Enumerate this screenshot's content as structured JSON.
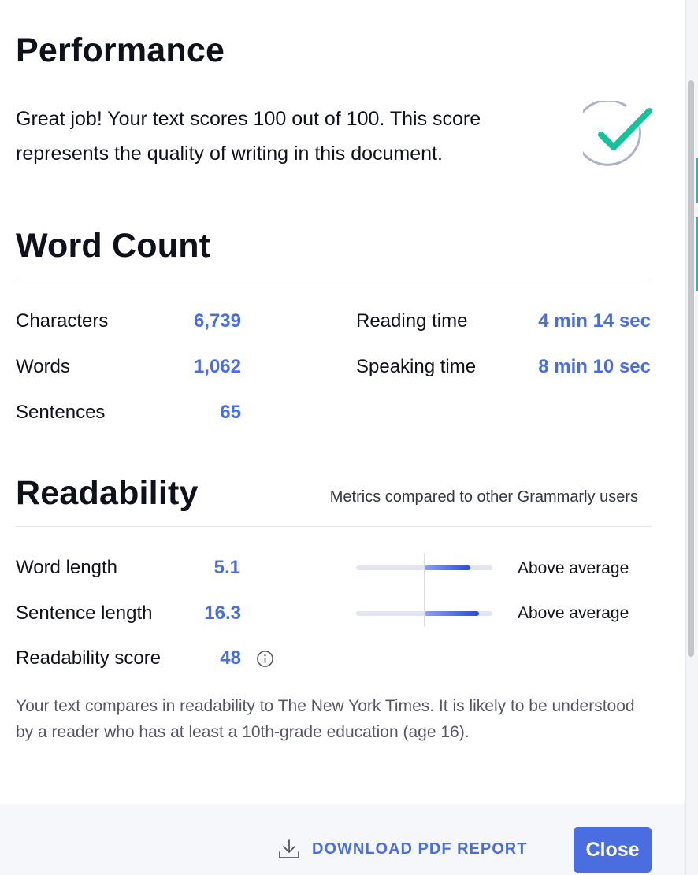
{
  "performance": {
    "title": "Performance",
    "text": "Great job! Your text scores 100 out of 100. This score represents the quality of writing in this document.",
    "icon": "check-circle-icon",
    "colors": {
      "check": "#15c39a",
      "ring": "#aab2cc"
    }
  },
  "word_count": {
    "title": "Word Count",
    "stats": [
      {
        "label": "Characters",
        "value": "6,739"
      },
      {
        "label": "Words",
        "value": "1,062"
      },
      {
        "label": "Sentences",
        "value": "65"
      },
      {
        "label": "Reading time",
        "value": "4 min 14 sec"
      },
      {
        "label": "Speaking time",
        "value": "8 min 10 sec"
      }
    ]
  },
  "readability": {
    "title": "Readability",
    "subtitle": "Metrics compared to other Grammarly users",
    "metrics": [
      {
        "label": "Word length",
        "value": "5.1",
        "comparison": "Above average",
        "bar_start": 0.5,
        "bar_end": 0.84
      },
      {
        "label": "Sentence length",
        "value": "16.3",
        "comparison": "Above average",
        "bar_start": 0.5,
        "bar_end": 0.9
      },
      {
        "label": "Readability score",
        "value": "48",
        "info_icon": "info-icon"
      }
    ],
    "note": "Your text compares in readability to The New York Times. It is likely to be understood by a reader who has at least a 10th-grade education (age 16)."
  },
  "footer": {
    "download_label": "DOWNLOAD PDF REPORT",
    "download_icon": "download-icon",
    "close_label": "Close"
  },
  "colors": {
    "accent": "#4a6ee0",
    "text": "#0e101a",
    "muted": "#545763"
  }
}
